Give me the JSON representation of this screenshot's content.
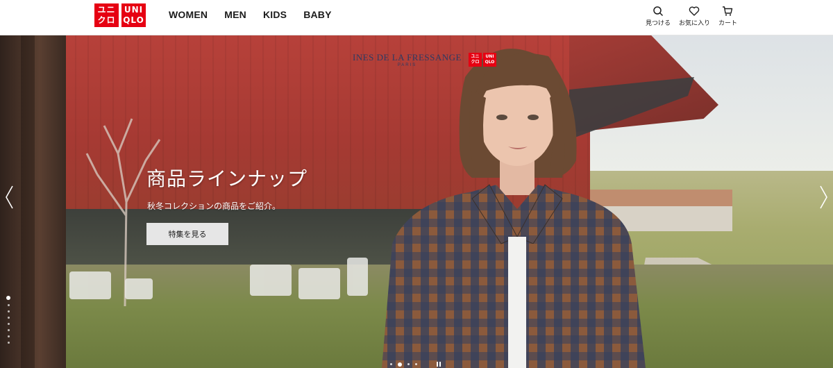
{
  "header": {
    "logo": {
      "left_top": "ユニ",
      "left_bottom": "クロ",
      "right_top": "UNI",
      "right_bottom": "QLO"
    },
    "nav": [
      "WOMEN",
      "MEN",
      "KIDS",
      "BABY"
    ],
    "utils": [
      {
        "label": "見つける",
        "icon": "search-icon"
      },
      {
        "label": "お気に入り",
        "icon": "heart-icon"
      },
      {
        "label": "カート",
        "icon": "cart-icon"
      }
    ]
  },
  "hero": {
    "collab": {
      "brand": "INES DE LA FRESSANGE",
      "city": "PARIS"
    },
    "headline": "商品ラインナップ",
    "subline": "秋冬コレクションの商品をご紹介。",
    "cta": "特集を見る",
    "vertical_pager": {
      "count": 8,
      "active": 0
    },
    "bottom_pager": {
      "count": 4,
      "active": 1
    }
  },
  "colors": {
    "brand_red": "#e60012",
    "text": "#1b1b1b",
    "collab_navy": "#2c3a63"
  }
}
